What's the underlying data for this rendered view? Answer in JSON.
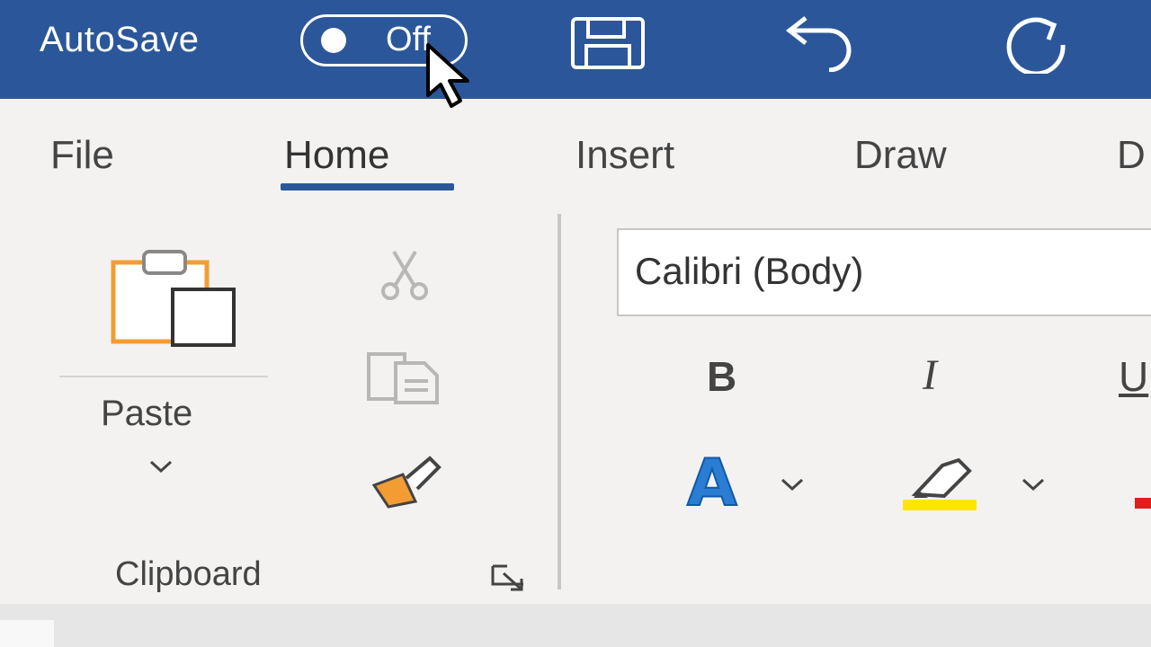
{
  "titlebar": {
    "autosave_label": "AutoSave",
    "toggle_state": "Off",
    "accent_color": "#2b579a",
    "icons": [
      "save-icon",
      "undo-icon",
      "redo-icon"
    ]
  },
  "tabs": [
    {
      "label": "File",
      "selected": false
    },
    {
      "label": "Home",
      "selected": true
    },
    {
      "label": "Insert",
      "selected": false
    },
    {
      "label": "Draw",
      "selected": false
    },
    {
      "label": "D",
      "selected": false
    }
  ],
  "clipboard": {
    "paste_label": "Paste",
    "group_label": "Clipboard",
    "icons": [
      "paste-icon",
      "cut-icon",
      "copy-icon",
      "format-painter-icon",
      "dialog-launcher-icon"
    ]
  },
  "font": {
    "font_name": "Calibri (Body)",
    "bold_label": "B",
    "italic_label": "I",
    "underline_label": "U",
    "font_color_label": "A",
    "font_color": "#2b7cd3",
    "highlight_color": "#ffe600"
  }
}
